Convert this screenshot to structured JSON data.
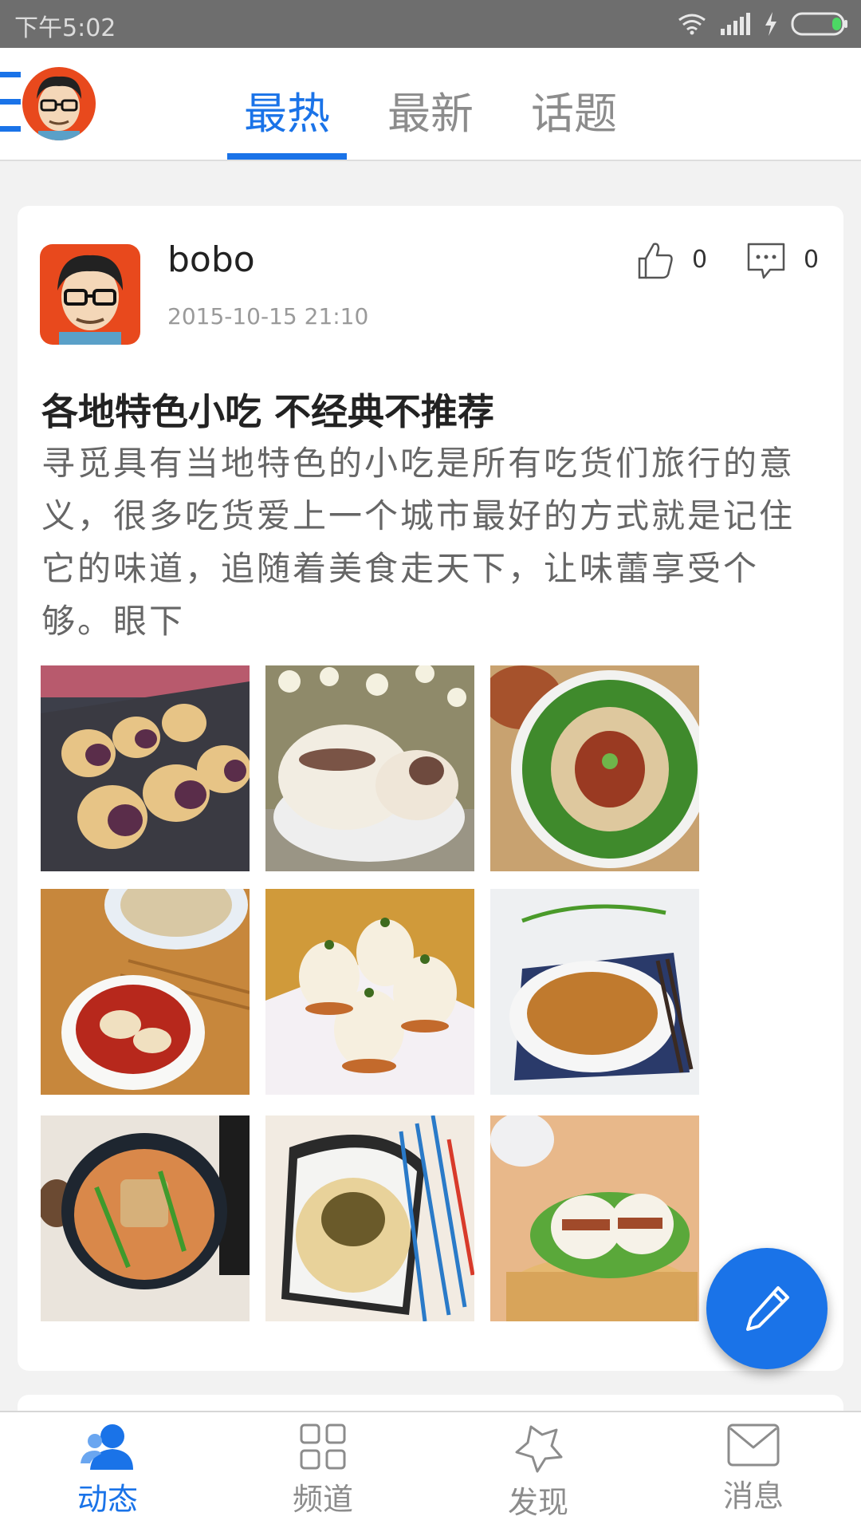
{
  "status_bar": {
    "time": "下午5:02"
  },
  "nav": {
    "tabs": [
      {
        "label": "最热",
        "active": true
      },
      {
        "label": "最新",
        "active": false
      },
      {
        "label": "话题",
        "active": false
      }
    ]
  },
  "post": {
    "author": "bobo",
    "time": "2015-10-15 21:10",
    "likes": "0",
    "comments": "0",
    "title": "各地特色小吃  不经典不推荐",
    "body": "寻觅具有当地特色的小吃是所有吃货们旅行的意义，很多吃货爱上一个城市最好的方式就是记住它的味道，追随着美食走天下，让味蕾享受个够。眼下",
    "images": [
      "purple-yam-rolls-photo",
      "meat-bun-photo",
      "cold-dish-broccoli-photo",
      "spicy-wontons-photo",
      "xiaolongbao-buns-photo",
      "noodles-plate-photo",
      "shacha-noodle-soup-photo",
      "shrimp-noodles-photo",
      "gua-bao-photo"
    ]
  },
  "bottom_nav": {
    "items": [
      {
        "label": "动态",
        "icon": "people-icon",
        "active": true
      },
      {
        "label": "频道",
        "icon": "grid-icon",
        "active": false
      },
      {
        "label": "发现",
        "icon": "star-icon",
        "active": false
      },
      {
        "label": "消息",
        "icon": "mail-icon",
        "active": false
      }
    ]
  },
  "colors": {
    "accent": "#1a73e8",
    "status_bar": "#6e6e6e",
    "background": "#f2f2f2"
  }
}
